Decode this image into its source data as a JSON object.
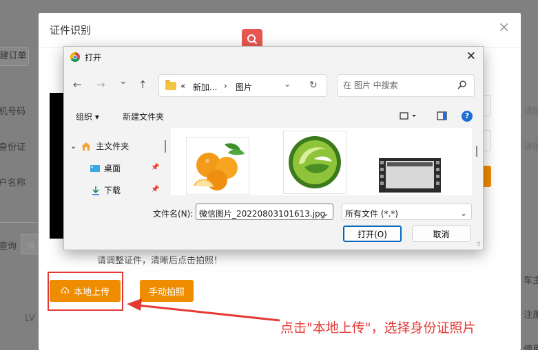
{
  "background_app": {
    "create_order_fragment": "建订单",
    "phone_fragment": "机号码",
    "id_fragment": "身份证",
    "account_fragment": "户名称",
    "query_fragment": "查询",
    "please_fragment": "请",
    "lv_fragment": "LV",
    "right_please_1": "请输",
    "right_please_2": "请输",
    "right_car_owner": "车主",
    "right_register": "注册",
    "right_use": "使用"
  },
  "modal": {
    "title": "证件识别",
    "close_symbol": "×",
    "hint": "请调整证件，清晰后点击拍照！",
    "upload_button": "本地上传",
    "manual_button": "手动拍照"
  },
  "file_dialog": {
    "title": "打开",
    "close_symbol": "✕",
    "back_symbol": "←",
    "forward_symbol": "→",
    "recent_symbol": "⌄",
    "up_symbol": "↑",
    "address": {
      "prefix": "«",
      "segment1": "新加...",
      "separator": "›",
      "segment2": "图片",
      "chevron": "⌄",
      "refresh": "↻"
    },
    "search_placeholder": "在 图片 中搜索",
    "toolbar": {
      "organize": "组织 ▾",
      "new_folder": "新建文件夹",
      "help": "?"
    },
    "nav_items": [
      {
        "label": "主文件夹",
        "expand": "⌄"
      },
      {
        "label": "桌面"
      },
      {
        "label": "下载"
      }
    ],
    "file_name_label": "文件名(N):",
    "file_name_value": "微信图片_20220803101613.jpg",
    "file_type_value": "所有文件 (*.*)",
    "open_button": "打开(O)",
    "cancel_button": "取消"
  },
  "annotation": {
    "text": "点击\"本地上传\"，选择身份证照片",
    "color": "#e53935"
  },
  "colors": {
    "accent_orange": "#f08c00",
    "highlight_red": "#e53935",
    "search_badge": "#e8574f"
  }
}
